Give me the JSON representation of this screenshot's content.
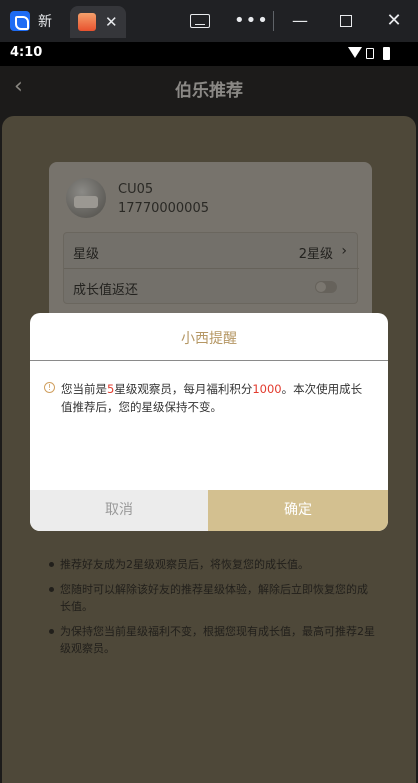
{
  "browser": {
    "tab1_label": "新",
    "tab_close": "✕",
    "more": "•••",
    "minimize": "—",
    "close": "✕"
  },
  "statusbar": {
    "time": "4:10"
  },
  "page": {
    "title": "伯乐推荐",
    "back": "‹"
  },
  "user": {
    "name": "CU05",
    "phone": "17770000005"
  },
  "rows": {
    "star_label": "星级",
    "star_value": "2星级",
    "growth_label": "成长值返还"
  },
  "notes": [
    "推荐好友成为2星级观察员后，将恢复您的成长值。",
    "您随时可以解除该好友的推荐星级体验，解除后立即恢复您的成长值。",
    "为保持您当前星级福利不变，根据您现有成长值，最高可推荐2星级观察员。"
  ],
  "modal": {
    "title": "小西提醒",
    "msg_part1": "您当前是",
    "msg_star": "5",
    "msg_part2": "星级观察员，每月福利积分",
    "msg_points": "1000",
    "msg_part3": "。本次使用成长值推荐后，您的星级保持不变。",
    "cancel": "取消",
    "confirm": "确定"
  },
  "colors": {
    "accent": "#d3c090",
    "title": "#b59764",
    "highlight": "#e23b2e"
  }
}
